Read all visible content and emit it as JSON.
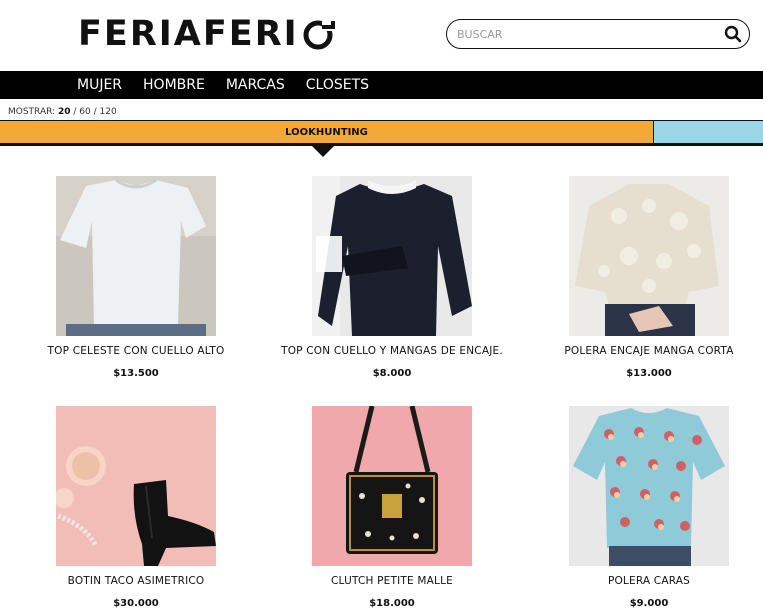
{
  "header": {
    "logo_text": "FERIAFERI",
    "search_placeholder": "BUSCAR"
  },
  "nav": {
    "items": [
      "MUJER",
      "HOMBRE",
      "MARCAS",
      "CLOSETS"
    ]
  },
  "show": {
    "label": "MOSTRAR:",
    "options": [
      "20",
      "60",
      "120"
    ],
    "separator": " / "
  },
  "tabs": {
    "active": "LOOKHUNTING"
  },
  "colors": {
    "tab_active": "#f4a835",
    "tab_secondary": "#99d6e6",
    "nav_bg": "#000000"
  },
  "products": [
    {
      "name": "TOP CELESTE CON CUELLO ALTO",
      "price": "$13.500"
    },
    {
      "name": "TOP CON CUELLO Y MANGAS DE ENCAJE.",
      "price": "$8.000"
    },
    {
      "name": "POLERA ENCAJE MANGA CORTA",
      "price": "$13.000"
    },
    {
      "name": "BOTIN TACO ASIMETRICO",
      "price": "$30.000"
    },
    {
      "name": "CLUTCH PETITE MALLE",
      "price": "$18.000"
    },
    {
      "name": "POLERA CARAS",
      "price": "$9.000"
    }
  ]
}
